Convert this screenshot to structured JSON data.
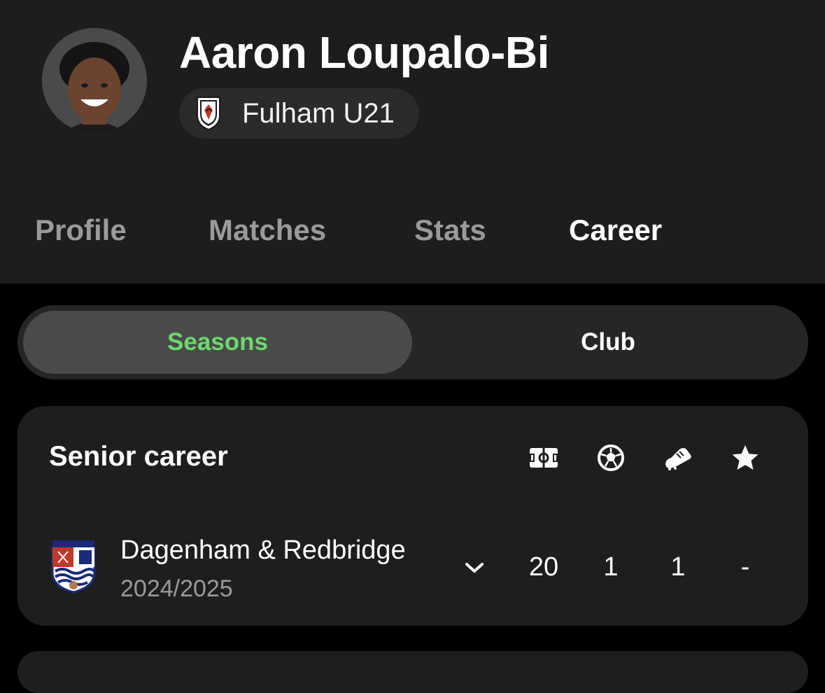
{
  "player": {
    "name": "Aaron Loupalo-Bi",
    "team": "Fulham U21"
  },
  "tabs": [
    {
      "label": "Profile",
      "active": false
    },
    {
      "label": "Matches",
      "active": false
    },
    {
      "label": "Stats",
      "active": false
    },
    {
      "label": "Career",
      "active": true
    }
  ],
  "segmented": {
    "options": [
      "Seasons",
      "Club"
    ],
    "selected": "Seasons"
  },
  "career": {
    "title": "Senior career",
    "columns": [
      "pitch-icon",
      "ball-icon",
      "boot-icon",
      "star-icon"
    ],
    "rows": [
      {
        "club": "Dagenham & Redbridge",
        "season": "2024/2025",
        "appearances": "20",
        "goals": "1",
        "assists": "1",
        "rating": "-"
      }
    ]
  },
  "colors": {
    "accent_green": "#6bd86b",
    "header_bg": "#1d1d1d",
    "card_bg": "#1e1e1e"
  }
}
